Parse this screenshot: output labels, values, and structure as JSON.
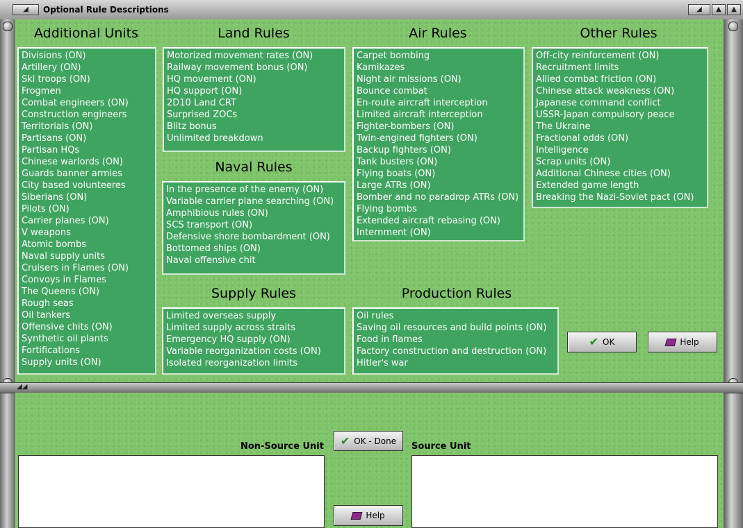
{
  "window": {
    "title": "Optional Rule Descriptions"
  },
  "additional_units": {
    "heading": "Additional Units",
    "items": [
      "Divisions (ON)",
      "Artillery (ON)",
      "Ski troops (ON)",
      "Frogmen",
      "Combat engineers (ON)",
      "Construction engineers",
      "Territorials (ON)",
      "Partisans (ON)",
      "Partisan HQs",
      "Chinese warlords (ON)",
      "Guards banner armies",
      "City based volunteeres",
      "Siberians (ON)",
      "Pilots (ON)",
      "Carrier planes (ON)",
      "V weapons",
      "Atomic bombs",
      "Naval supply units",
      "Cruisers in Flames (ON)",
      "Convoys in Flames",
      "The Queens (ON)",
      "Rough seas",
      "Oil tankers",
      "Offensive chits (ON)",
      "Synthetic oil plants",
      "Fortifications",
      "Supply units (ON)"
    ]
  },
  "land_rules": {
    "heading": "Land Rules",
    "items": [
      "Motorized movement rates (ON)",
      "Railway movement bonus (ON)",
      "HQ movement (ON)",
      "HQ support (ON)",
      "2D10 Land CRT",
      "Surprised ZOCs",
      "Blitz bonus",
      "Unlimited breakdown"
    ]
  },
  "naval_rules": {
    "heading": "Naval Rules",
    "items": [
      "In the presence of the enemy (ON)",
      "Variable carrier plane searching (ON)",
      "Amphibious rules (ON)",
      "SCS transport (ON)",
      "Defensive shore bombardment (ON)",
      "Bottomed ships (ON)",
      "Naval offensive chit"
    ]
  },
  "supply_rules": {
    "heading": "Supply Rules",
    "items": [
      "Limited overseas supply",
      "Limited supply across straits",
      "Emergency HQ supply (ON)",
      "Variable reorganization costs (ON)",
      "Isolated reorganization limits"
    ]
  },
  "air_rules": {
    "heading": "Air Rules",
    "items": [
      "Carpet bombing",
      "Kamikazes",
      "Night air missions (ON)",
      "Bounce combat",
      "En-route aircraft interception",
      "Limited aircraft interception",
      "Fighter-bombers (ON)",
      "Twin-engined fighters (ON)",
      "Backup fighters (ON)",
      "Tank busters (ON)",
      "Flying boats (ON)",
      "Large ATRs (ON)",
      "Bomber and no paradrop ATRs (ON)",
      "Flying bombs",
      "Extended aircraft rebasing (ON)",
      "Internment (ON)"
    ]
  },
  "production_rules": {
    "heading": "Production Rules",
    "items": [
      "Oil rules",
      "Saving oil resources and build points (ON)",
      "Food in flames",
      "Factory construction and destruction (ON)",
      "Hitler's war"
    ]
  },
  "other_rules": {
    "heading": "Other Rules",
    "items": [
      "Off-city reinforcement (ON)",
      "Recruitment limits",
      "Allied combat friction (ON)",
      "Chinese attack weakness (ON)",
      "Japanese command conflict",
      "USSR-Japan compulsory peace",
      "The Ukraine",
      "Fractional odds (ON)",
      "Intelligence",
      "Scrap units (ON)",
      "Additional Chinese cities (ON)",
      "Extended game length",
      "Breaking the Nazi-Soviet pact (ON)"
    ]
  },
  "buttons": {
    "ok": "OK",
    "help": "Help",
    "ok_done": "OK - Done",
    "help2": "Help"
  },
  "bottom": {
    "non_source_label": "Non-Source Unit",
    "source_label": "Source Unit"
  }
}
